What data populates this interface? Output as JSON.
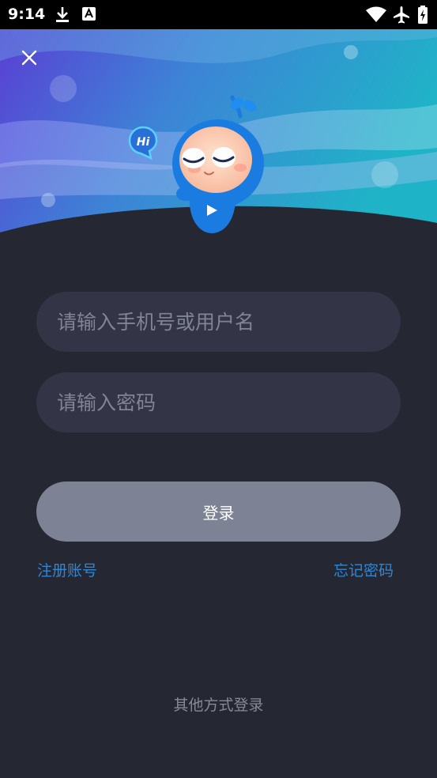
{
  "status_bar": {
    "time": "9:14"
  },
  "hero": {
    "bubble_text": "Hi"
  },
  "form": {
    "username_placeholder": "请输入手机号或用户名",
    "password_placeholder": "请输入密码",
    "login_label": "登录"
  },
  "links": {
    "register": "注册账号",
    "forgot_password": "忘记密码"
  },
  "other_login": "其他方式登录",
  "colors": {
    "background": "#252733",
    "field": "#333445",
    "button": "#7d8394",
    "link": "#2f87d4"
  }
}
